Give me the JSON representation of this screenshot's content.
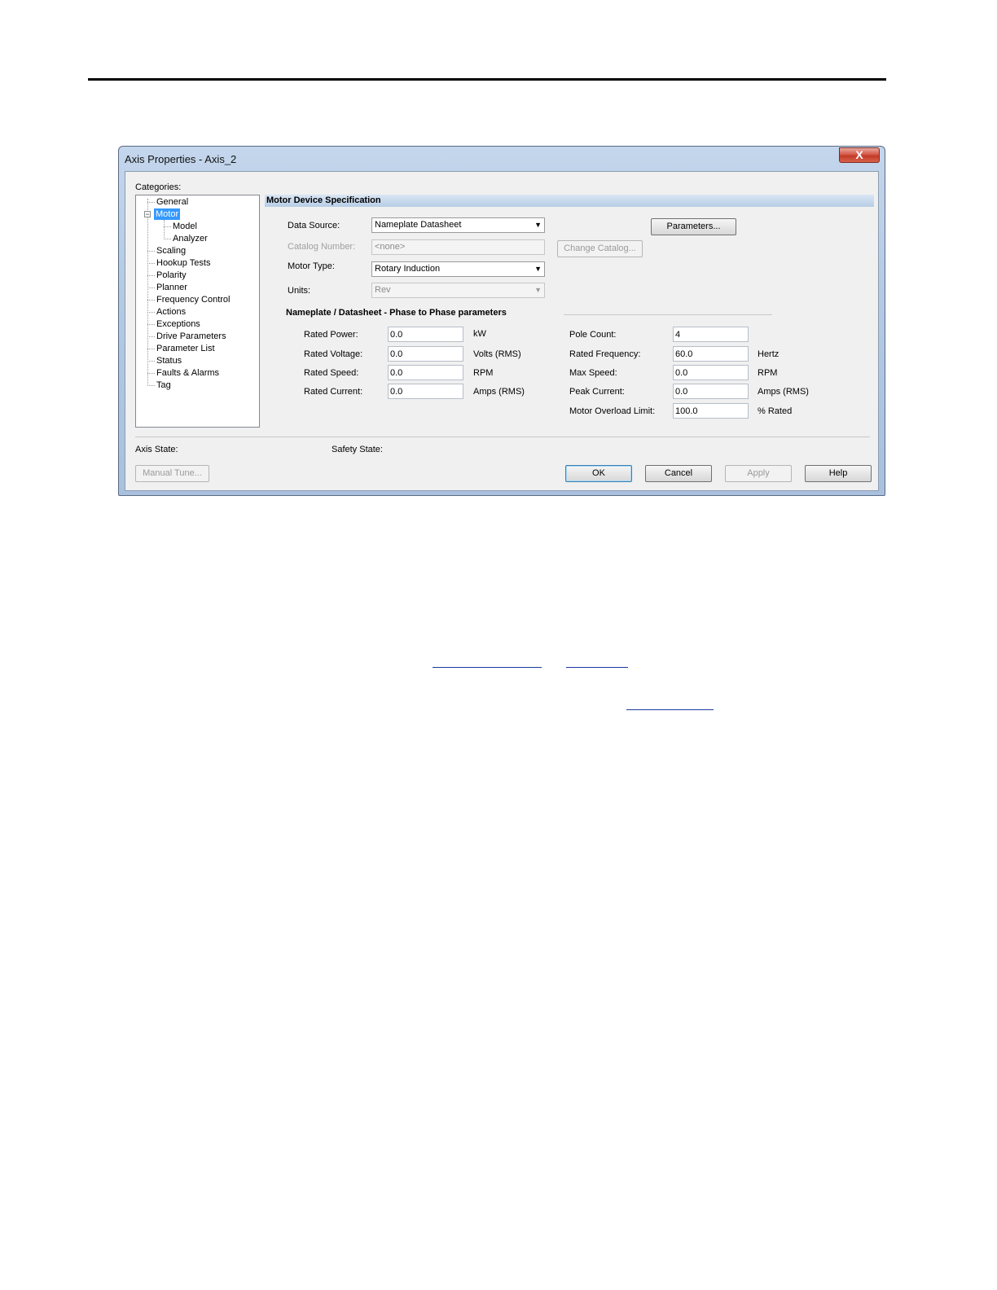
{
  "window": {
    "title": "Axis Properties - Axis_2",
    "close_glyph": "X"
  },
  "categories_label": "Categories:",
  "tree": {
    "general": "General",
    "motor": "Motor",
    "model": "Model",
    "analyzer": "Analyzer",
    "scaling": "Scaling",
    "hookup_tests": "Hookup Tests",
    "polarity": "Polarity",
    "planner": "Planner",
    "frequency_control": "Frequency Control",
    "actions": "Actions",
    "exceptions": "Exceptions",
    "drive_parameters": "Drive Parameters",
    "parameter_list": "Parameter List",
    "status": "Status",
    "faults_alarms": "Faults & Alarms",
    "tag": "Tag",
    "expander_glyph": "−"
  },
  "section_title": "Motor Device Specification",
  "form": {
    "data_source_label": "Data Source:",
    "data_source_value": "Nameplate Datasheet",
    "catalog_label": "Catalog Number:",
    "catalog_value": "<none>",
    "motor_type_label": "Motor Type:",
    "motor_type_value": "Rotary Induction",
    "units_label": "Units:",
    "units_value": "Rev",
    "parameters_button": "Parameters...",
    "change_catalog_button": "Change Catalog...",
    "dropdown_arrow": "▼"
  },
  "nameplate": {
    "title": "Nameplate / Datasheet - Phase to Phase parameters",
    "rated_power": {
      "label": "Rated Power:",
      "value": "0.0",
      "unit": "kW"
    },
    "rated_voltage": {
      "label": "Rated Voltage:",
      "value": "0.0",
      "unit": "Volts (RMS)"
    },
    "rated_speed": {
      "label": "Rated Speed:",
      "value": "0.0",
      "unit": "RPM"
    },
    "rated_current": {
      "label": "Rated Current:",
      "value": "0.0",
      "unit": "Amps (RMS)"
    },
    "pole_count": {
      "label": "Pole Count:",
      "value": "4"
    },
    "rated_frequency": {
      "label": "Rated Frequency:",
      "value": "60.0",
      "unit": "Hertz"
    },
    "max_speed": {
      "label": "Max Speed:",
      "value": "0.0",
      "unit": "RPM"
    },
    "peak_current": {
      "label": "Peak Current:",
      "value": "0.0",
      "unit": "Amps (RMS)"
    },
    "overload_limit": {
      "label": "Motor Overload Limit:",
      "value": "100.0",
      "unit": "% Rated"
    }
  },
  "status": {
    "axis_state_label": "Axis State:",
    "safety_state_label": "Safety State:"
  },
  "buttons": {
    "manual_tune": "Manual Tune...",
    "ok": "OK",
    "cancel": "Cancel",
    "apply": "Apply",
    "help": "Help"
  },
  "colors": {
    "selection": "#3399ff",
    "title_gradient": "#b3c9e4",
    "close": "#c13a27"
  }
}
